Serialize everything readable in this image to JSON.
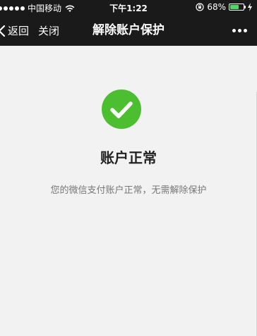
{
  "status_bar": {
    "carrier": "中国移动",
    "time": "下午1:22",
    "battery_percent": "68%",
    "battery_level": 0.68,
    "icons": [
      "signal-dots-icon",
      "wifi-icon",
      "rotation-lock-icon",
      "battery-icon",
      "charging-bolt-icon"
    ]
  },
  "navbar": {
    "back_label": "返回",
    "close_label": "关闭",
    "title": "解除账户保护",
    "more_icon": "more-dots-icon"
  },
  "main": {
    "status_icon": "check-circle-icon",
    "status_title": "账户正常",
    "status_desc": "您的微信支付账户正常，无需解除保护"
  },
  "colors": {
    "bar_bg": "#1a1a1a",
    "page_bg": "#f2f2f2",
    "success_green": "#4cbf30",
    "battery_green": "#4cd964"
  }
}
